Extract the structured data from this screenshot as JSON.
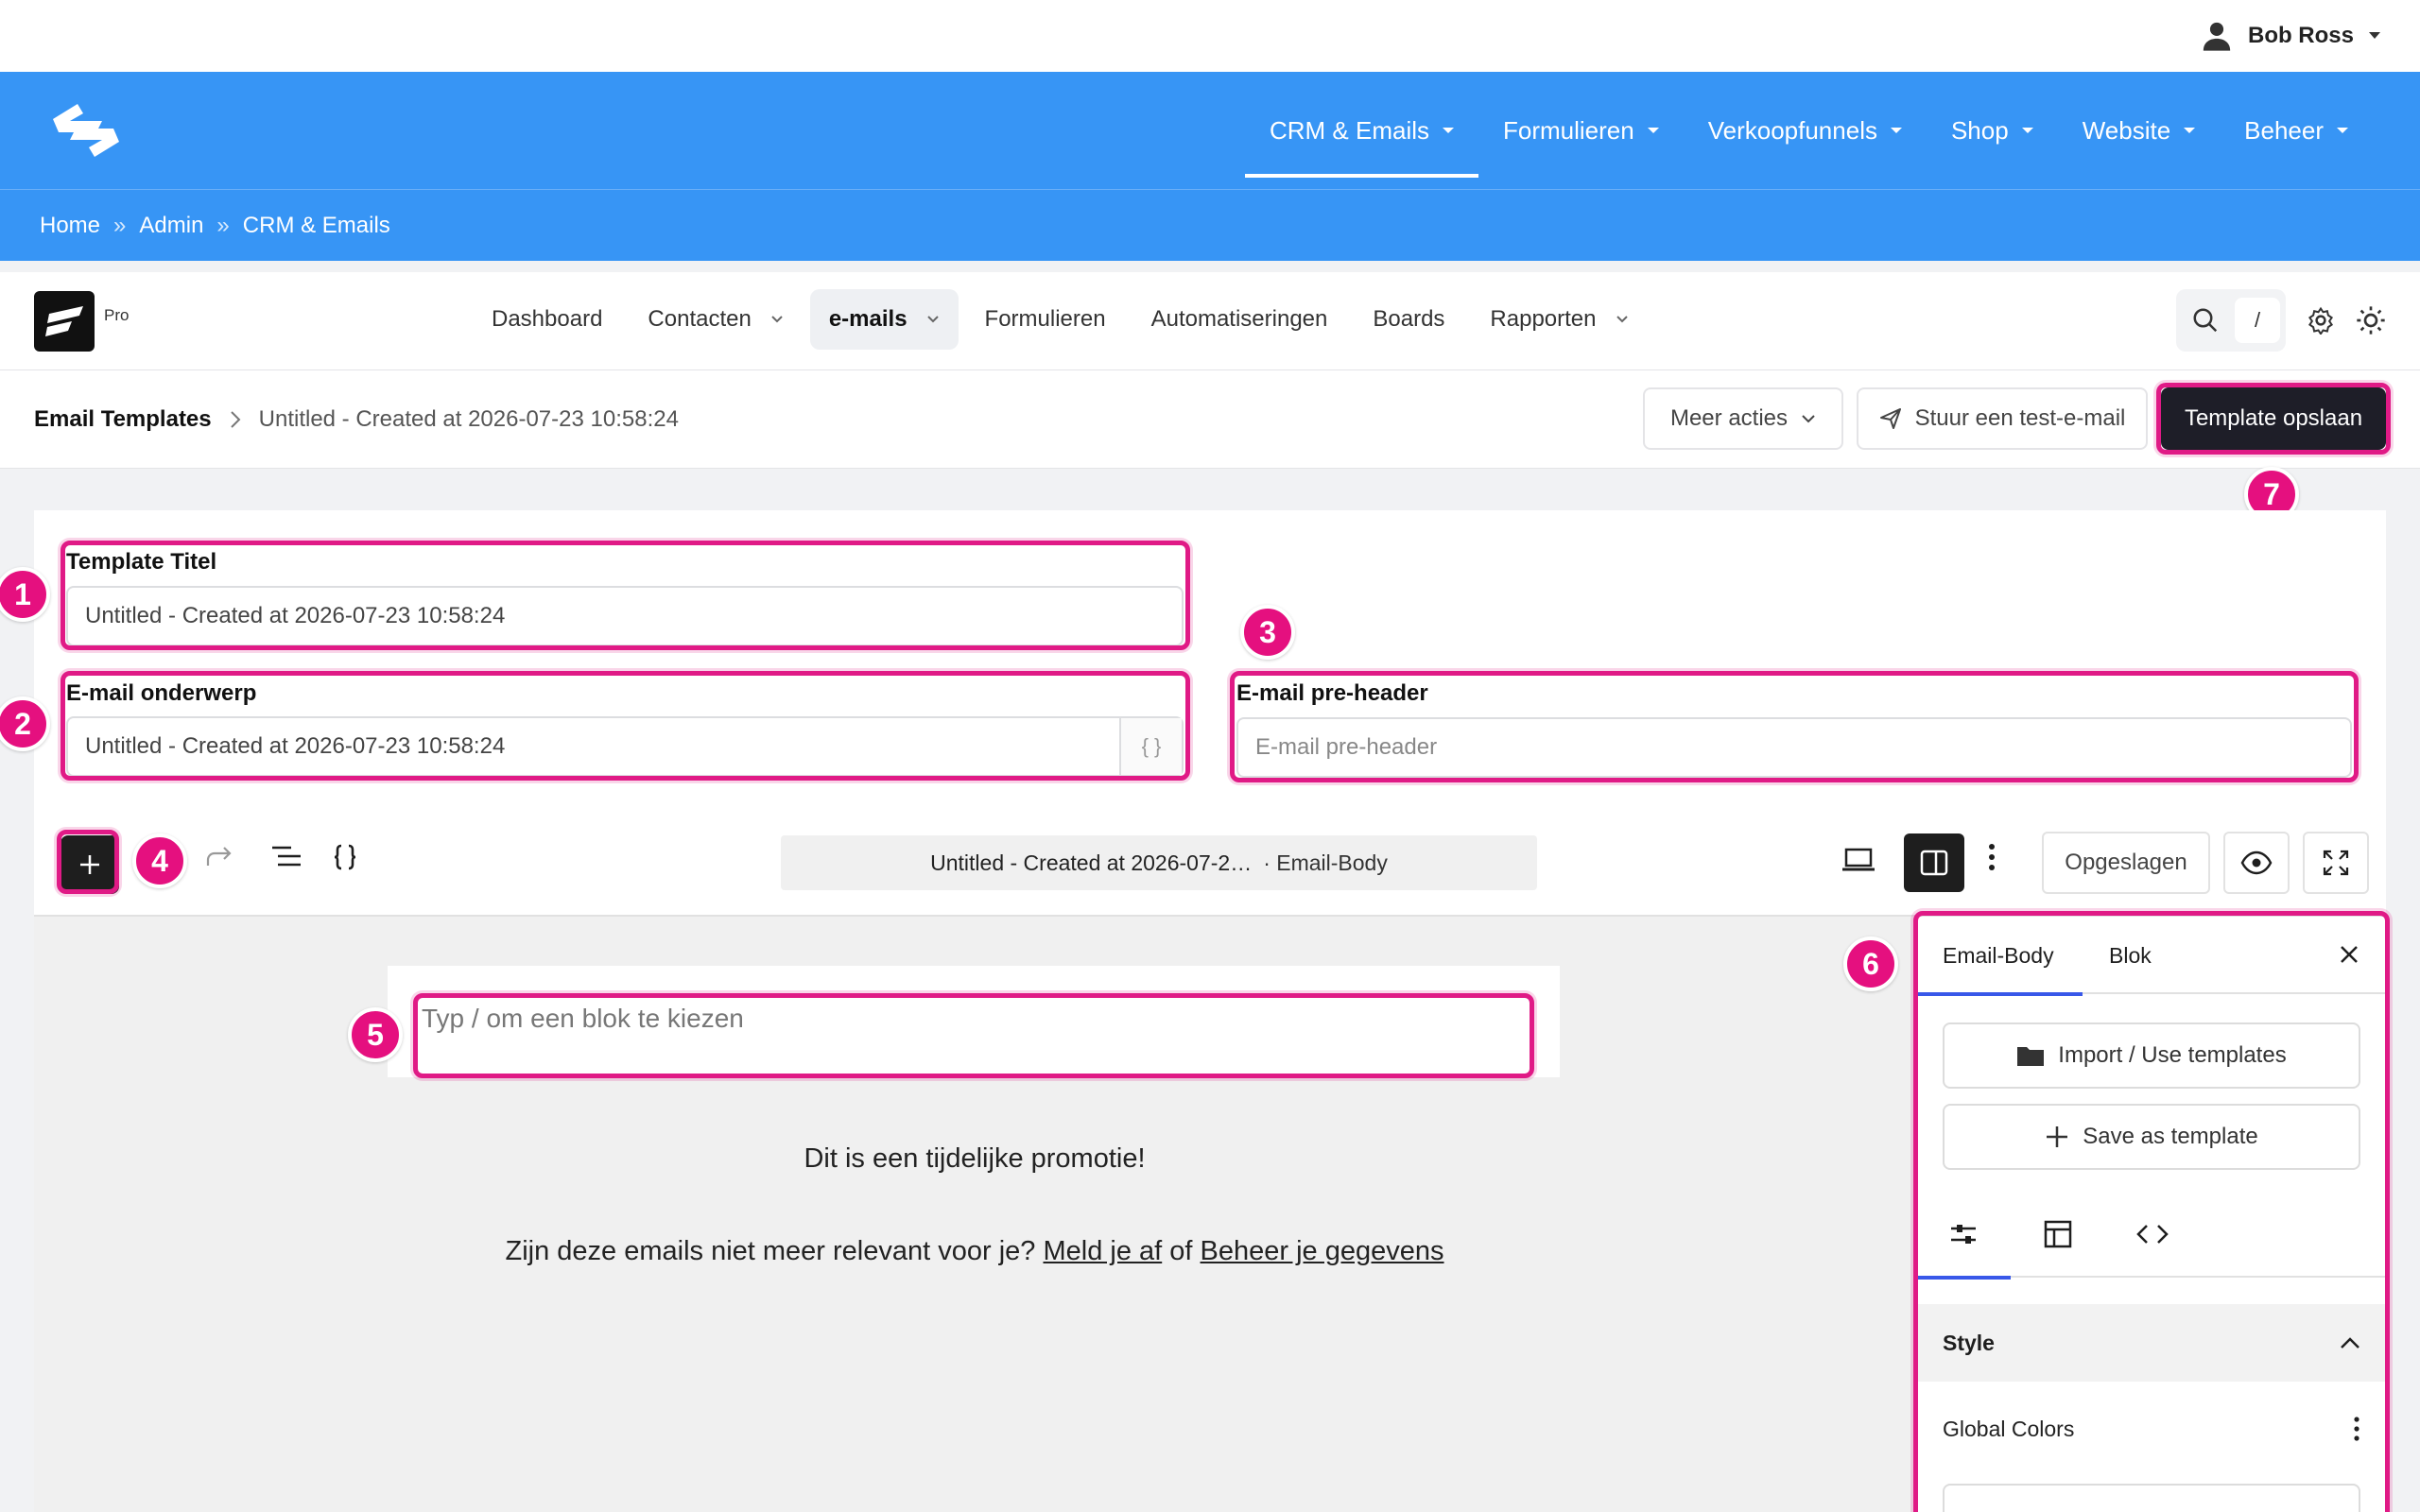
{
  "user": {
    "name": "Bob Ross",
    "icon": "user-icon"
  },
  "main_menu": [
    {
      "label": "CRM & Emails",
      "active": true
    },
    {
      "label": "Formulieren",
      "active": false
    },
    {
      "label": "Verkoopfunnels",
      "active": false
    },
    {
      "label": "Shop",
      "active": false
    },
    {
      "label": "Website",
      "active": false
    },
    {
      "label": "Beheer",
      "active": false
    }
  ],
  "breadcrumb": [
    "Home",
    "Admin",
    "CRM & Emails"
  ],
  "breadcrumb_sep": "»",
  "app": {
    "badge": "Pro",
    "nav": [
      {
        "label": "Dashboard",
        "dropdown": false,
        "active": false
      },
      {
        "label": "Contacten",
        "dropdown": true,
        "active": false
      },
      {
        "label": "e-mails",
        "dropdown": true,
        "active": true
      },
      {
        "label": "Formulieren",
        "dropdown": false,
        "active": false
      },
      {
        "label": "Automatiseringen",
        "dropdown": false,
        "active": false
      },
      {
        "label": "Boards",
        "dropdown": false,
        "active": false
      },
      {
        "label": "Rapporten",
        "dropdown": true,
        "active": false
      }
    ],
    "search_shortcut": "/"
  },
  "page": {
    "crumb_root": "Email Templates",
    "crumb_current": "Untitled - Created at 2026-07-23 10:58:24",
    "more_actions": "Meer acties",
    "send_test": "Stuur een test-e-mail",
    "save_template": "Template opslaan"
  },
  "form": {
    "title_label": "Template Titel",
    "title_value": "Untitled - Created at 2026-07-23 10:58:24",
    "subject_label": "E-mail onderwerp",
    "subject_value": "Untitled - Created at 2026-07-23 10:58:24",
    "subject_brace": "{ }",
    "preheader_label": "E-mail pre-header",
    "preheader_placeholder": "E-mail pre-header"
  },
  "editor": {
    "doc_title": "Untitled - Created at 2026-07-2…",
    "doc_sub": "· Email-Body",
    "saved_label": "Opgeslagen",
    "block_placeholder": "Typ / om een blok te kiezen",
    "promo_text": "Dit is een tijdelijke promotie!",
    "unsub_prefix": "Zijn deze emails niet meer relevant voor je?",
    "unsub_link": "Meld je af",
    "unsub_mid": "of",
    "manage_link": "Beheer je gegevens"
  },
  "panel": {
    "tab_body": "Email-Body",
    "tab_block": "Blok",
    "import_label": "Import / Use templates",
    "save_as_label": "Save as template",
    "style_header": "Style",
    "global_colors": "Global Colors"
  },
  "badges": [
    "1",
    "2",
    "3",
    "4",
    "5",
    "6",
    "7"
  ],
  "colors": {
    "brand_blue": "#3795f5",
    "highlight": "#e01a86",
    "dark": "#1e1e28"
  }
}
